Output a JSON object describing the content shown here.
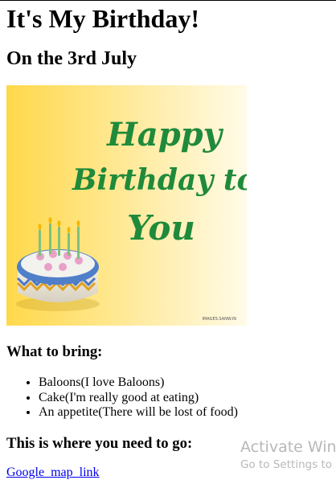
{
  "page": {
    "title": "It's My Birthday!",
    "subtitle": "On the 3rd July"
  },
  "banner": {
    "line1": "Happy",
    "line2": "Birthday to",
    "line3": "You",
    "credit": "IMAGES.SANW.IN",
    "colors": {
      "gradient_start": "#ffd84a",
      "gradient_end": "#fffbe8",
      "text_green": "#1f8a3b"
    }
  },
  "bring": {
    "heading": "What to bring:",
    "items": [
      "Baloons(I love Baloons)",
      "Cake(I'm really good at eating)",
      "An appetite(There will be lost of food)"
    ]
  },
  "location": {
    "heading": "This is where you need to go:",
    "link_text": "Google_map_link"
  },
  "watermark": {
    "title": "Activate Windows",
    "subtitle": "Go to Settings to activate Windows."
  }
}
